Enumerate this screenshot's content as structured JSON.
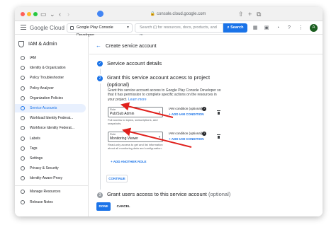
{
  "browser": {
    "url": "console.cloud.google.com"
  },
  "topbar": {
    "logo_text": "Google Cloud",
    "project": "Google Play Console Developer",
    "search_placeholder": "Search (/) for resources, docs, products, and m...",
    "search_button": "Search",
    "avatar_letter": "A"
  },
  "nav": {
    "title": "IAM & Admin",
    "items": [
      {
        "label": "IAM"
      },
      {
        "label": "Identity & Organization"
      },
      {
        "label": "Policy Troubleshooter"
      },
      {
        "label": "Policy Analyzer"
      },
      {
        "label": "Organization Policies"
      },
      {
        "label": "Service Accounts"
      },
      {
        "label": "Workload Identity Federat..."
      },
      {
        "label": "Workforce Identity Federat..."
      },
      {
        "label": "Labels"
      },
      {
        "label": "Tags"
      },
      {
        "label": "Settings"
      },
      {
        "label": "Privacy & Security"
      },
      {
        "label": "Identity-Aware Proxy"
      }
    ],
    "bottom_items": [
      {
        "label": "Manage Resources"
      },
      {
        "label": "Release Notes"
      }
    ],
    "active_index": 5
  },
  "main": {
    "page_title": "Create service account",
    "step1_title": "Service account details",
    "step2_number": "2",
    "step2_title": "Grant this service account access to project",
    "step2_subtitle": "(optional)",
    "step2_desc": "Grant this service account access to Google Play Console Developer so that it has permission to complete specific actions on the resources in your project.",
    "step2_learn": "Learn more",
    "roles": [
      {
        "label": "Role",
        "value": "Pub/Sub Admin",
        "helper": "Full access to topics, subscriptions, and snapshots.",
        "condition_label": "IAM condition (optional)",
        "add_condition": "+ ADD IAM CONDITION"
      },
      {
        "label": "Role",
        "value": "Monitoring Viewer",
        "helper": "Read-only access to get and list information about all monitoring data and configuration.",
        "condition_label": "IAM condition (optional)",
        "add_condition": "+ ADD IAM CONDITION"
      }
    ],
    "add_role": "+ ADD ANOTHER ROLE",
    "continue": "CONTINUE",
    "step3_number": "3",
    "step3_title": "Grant users access to this service account",
    "step3_subtitle": "(optional)",
    "done": "DONE",
    "cancel": "CANCEL"
  },
  "colors": {
    "accent": "#1a73e8",
    "annotation_arrow": "#e0201c",
    "active_nav_bg": "#e8f0fe"
  }
}
